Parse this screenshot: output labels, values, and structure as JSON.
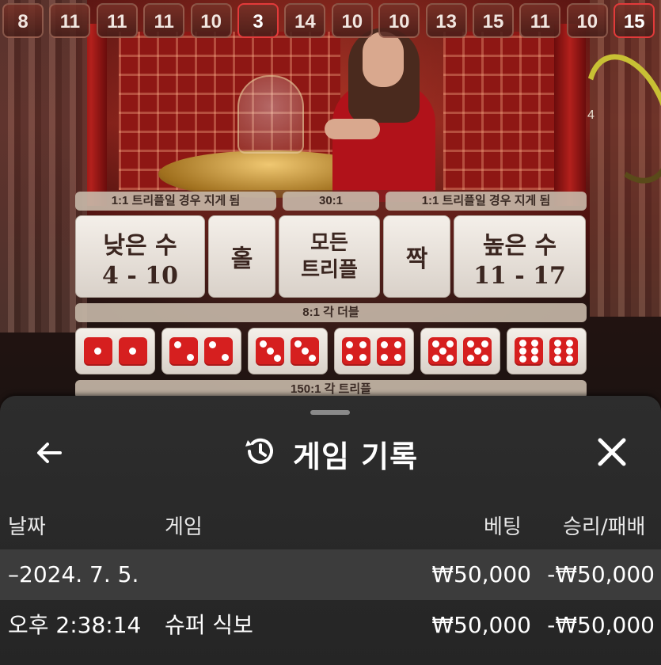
{
  "history": [
    {
      "value": "8",
      "highlight": false
    },
    {
      "value": "11",
      "highlight": false
    },
    {
      "value": "11",
      "highlight": false
    },
    {
      "value": "11",
      "highlight": false
    },
    {
      "value": "10",
      "highlight": false
    },
    {
      "value": "3",
      "highlight": true
    },
    {
      "value": "14",
      "highlight": false
    },
    {
      "value": "10",
      "highlight": false
    },
    {
      "value": "10",
      "highlight": false
    },
    {
      "value": "13",
      "highlight": false
    },
    {
      "value": "15",
      "highlight": false
    },
    {
      "value": "11",
      "highlight": false
    },
    {
      "value": "10",
      "highlight": false
    },
    {
      "value": "15",
      "highlight": true
    }
  ],
  "timer": {
    "value": "4"
  },
  "board": {
    "small_payout": "1:1 트리플일 경우 지게 됨",
    "any_triple_payout": "30:1",
    "big_payout": "1:1 트리플일 경우 지게 됨",
    "small_title": "낮은 수",
    "small_range": "4 - 10",
    "odd": "홀",
    "any_triple_line1": "모든",
    "any_triple_line2": "트리플",
    "even": "짝",
    "big_title": "높은 수",
    "big_range": "11 - 17",
    "double_payout": "8:1 각 더블",
    "doubles": [
      1,
      2,
      3,
      4,
      5,
      6
    ],
    "triple_payout": "150:1 각 트리플"
  },
  "sheet": {
    "title": "게임 기록",
    "back_icon": "arrow-left-icon",
    "history_icon": "history-clock-icon",
    "close_icon": "close-icon",
    "columns": {
      "date": "날짜",
      "game": "게임",
      "bet": "베팅",
      "result": "승리/패배"
    },
    "date_group": {
      "date": "–2024. 7. 5.",
      "bet": "₩50,000",
      "result": "-₩50,000"
    },
    "entries": [
      {
        "time": "오후 2:38:14",
        "game": "슈퍼 식보",
        "bet": "₩50,000",
        "result": "-₩50,000"
      }
    ]
  },
  "colors": {
    "accent_red": "#d61f1f",
    "sheet_bg": "#2d2d2d",
    "timer_yellow": "#c8c034"
  }
}
